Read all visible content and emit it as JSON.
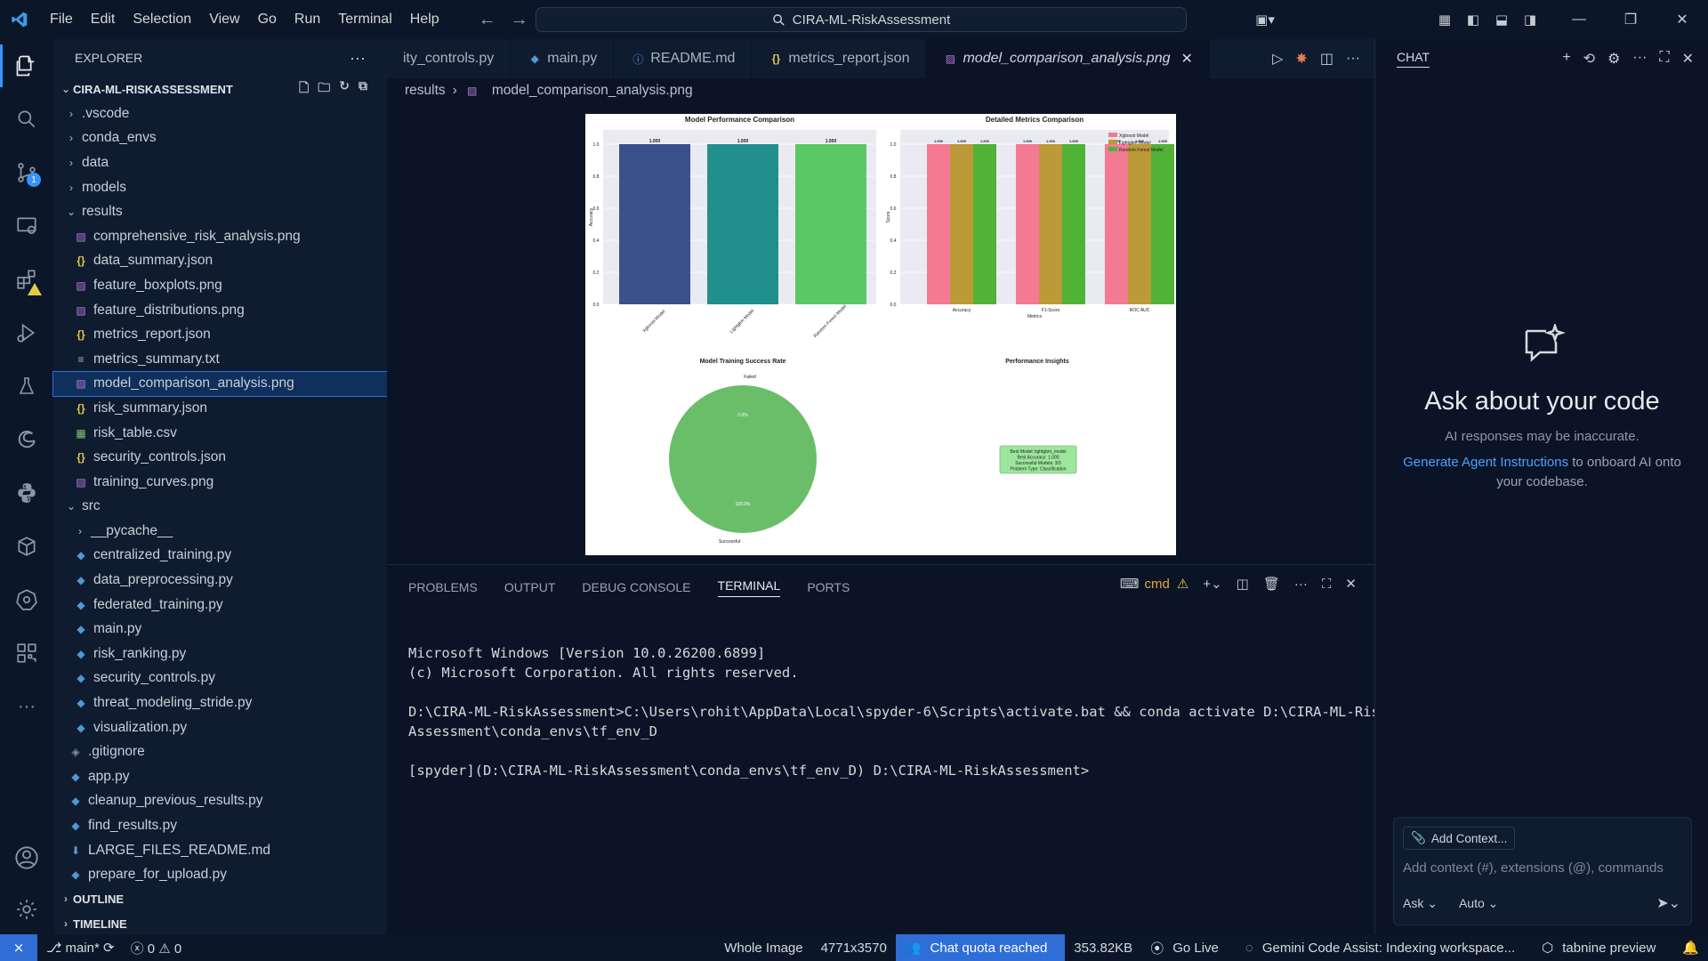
{
  "menu": [
    "File",
    "Edit",
    "Selection",
    "View",
    "Go",
    "Run",
    "Terminal",
    "Help"
  ],
  "search": {
    "label": "CIRA-ML-RiskAssessment"
  },
  "explorer": {
    "title": "EXPLORER",
    "project": "CIRA-ML-RISKASSESSMENT",
    "tree": [
      {
        "label": ".vscode",
        "type": "folder",
        "depth": 1,
        "open": false
      },
      {
        "label": "conda_envs",
        "type": "folder",
        "depth": 1,
        "open": false
      },
      {
        "label": "data",
        "type": "folder",
        "depth": 1,
        "open": false
      },
      {
        "label": "models",
        "type": "folder",
        "depth": 1,
        "open": false
      },
      {
        "label": "results",
        "type": "folder",
        "depth": 1,
        "open": true
      },
      {
        "label": "comprehensive_risk_analysis.png",
        "type": "png",
        "depth": 2
      },
      {
        "label": "data_summary.json",
        "type": "json",
        "depth": 2
      },
      {
        "label": "feature_boxplots.png",
        "type": "png",
        "depth": 2
      },
      {
        "label": "feature_distributions.png",
        "type": "png",
        "depth": 2
      },
      {
        "label": "metrics_report.json",
        "type": "json",
        "depth": 2
      },
      {
        "label": "metrics_summary.txt",
        "type": "txt",
        "depth": 2
      },
      {
        "label": "model_comparison_analysis.png",
        "type": "png",
        "depth": 2,
        "selected": true
      },
      {
        "label": "risk_summary.json",
        "type": "json",
        "depth": 2
      },
      {
        "label": "risk_table.csv",
        "type": "csv",
        "depth": 2
      },
      {
        "label": "security_controls.json",
        "type": "json",
        "depth": 2
      },
      {
        "label": "training_curves.png",
        "type": "png",
        "depth": 2
      },
      {
        "label": "src",
        "type": "folder",
        "depth": 1,
        "open": true
      },
      {
        "label": "__pycache__",
        "type": "folder",
        "depth": 2,
        "open": false
      },
      {
        "label": "centralized_training.py",
        "type": "py",
        "depth": 2
      },
      {
        "label": "data_preprocessing.py",
        "type": "py",
        "depth": 2
      },
      {
        "label": "federated_training.py",
        "type": "py",
        "depth": 2
      },
      {
        "label": "main.py",
        "type": "py",
        "depth": 2
      },
      {
        "label": "risk_ranking.py",
        "type": "py",
        "depth": 2
      },
      {
        "label": "security_controls.py",
        "type": "py",
        "depth": 2
      },
      {
        "label": "threat_modeling_stride.py",
        "type": "py",
        "depth": 2
      },
      {
        "label": "visualization.py",
        "type": "py",
        "depth": 2
      },
      {
        "label": ".gitignore",
        "type": "git",
        "depth": 1
      },
      {
        "label": "app.py",
        "type": "py",
        "depth": 1
      },
      {
        "label": "cleanup_previous_results.py",
        "type": "py",
        "depth": 1
      },
      {
        "label": "find_results.py",
        "type": "py",
        "depth": 1
      },
      {
        "label": "LARGE_FILES_README.md",
        "type": "md",
        "depth": 1
      },
      {
        "label": "prepare_for_upload.py",
        "type": "py",
        "depth": 1
      }
    ],
    "outline": "OUTLINE",
    "timeline": "TIMELINE"
  },
  "tabs": [
    {
      "label": "ity_controls.py",
      "icon": "py"
    },
    {
      "label": "main.py",
      "icon": "py"
    },
    {
      "label": "README.md",
      "icon": "info"
    },
    {
      "label": "metrics_report.json",
      "icon": "json"
    },
    {
      "label": "model_comparison_analysis.png",
      "icon": "png",
      "active": true
    }
  ],
  "breadcrumb": {
    "folder": "results",
    "file": "model_comparison_analysis.png"
  },
  "figure": {
    "chart1": {
      "title": "Model Performance Comparison",
      "ylabel": "Accuracy",
      "categories": [
        "Xgboost Model",
        "Lightgbm Model",
        "Random Forest Model"
      ],
      "values": [
        1.0,
        1.0,
        1.0
      ],
      "value_labels": [
        "1.000",
        "1.000",
        "1.000"
      ],
      "colors": [
        "#3b518b",
        "#21908d",
        "#5ac864"
      ],
      "yticks": [
        "0.0",
        "0.2",
        "0.4",
        "0.6",
        "0.8",
        "1.0"
      ]
    },
    "chart2": {
      "title": "Detailed Metrics Comparison",
      "ylabel": "Score",
      "xlabel": "Metrics",
      "categories": [
        "Accuracy",
        "F1-Score",
        "ROC AUC"
      ],
      "series": [
        {
          "name": "Xgboost Model",
          "color": "#f37a92",
          "values": [
            1.0,
            1.0,
            1.0
          ]
        },
        {
          "name": "Lightgbm Model",
          "color": "#bc9a37",
          "values": [
            1.0,
            1.0,
            1.0
          ]
        },
        {
          "name": "Random Forest Model",
          "color": "#50b338",
          "values": [
            1.0,
            1.0,
            1.0
          ]
        }
      ],
      "value_label": "1.000",
      "yticks": [
        "0.0",
        "0.2",
        "0.4",
        "0.6",
        "0.8",
        "1.0"
      ]
    },
    "chart3": {
      "title": "Model Training Success Rate",
      "slices": [
        {
          "label": "Failed",
          "value": 0,
          "pct": "0.0%"
        },
        {
          "label": "Successful",
          "value": 100,
          "pct": "100.0%"
        }
      ],
      "color": "#6abe6a"
    },
    "chart4": {
      "title": "Performance Insights",
      "lines": [
        "Best Model: lightgbm_model",
        "Best Accuracy: 1.000",
        "Successful Models: 3/3",
        "Problem Type: Classification"
      ]
    }
  },
  "panel": {
    "tabs": [
      "PROBLEMS",
      "OUTPUT",
      "DEBUG CONSOLE",
      "TERMINAL",
      "PORTS"
    ],
    "active_tab": "TERMINAL",
    "shell": "cmd",
    "terminal_lines": [
      "Microsoft Windows [Version 10.0.26200.6899]",
      "(c) Microsoft Corporation. All rights reserved.",
      "",
      "D:\\CIRA-ML-RiskAssessment>C:\\Users\\rohit\\AppData\\Local\\spyder-6\\Scripts\\activate.bat && conda activate D:\\CIRA-ML-Risk",
      "Assessment\\conda_envs\\tf_env_D",
      "",
      "[spyder](D:\\CIRA-ML-RiskAssessment\\conda_envs\\tf_env_D) D:\\CIRA-ML-RiskAssessment>"
    ]
  },
  "chat": {
    "title": "CHAT",
    "heading": "Ask about your code",
    "disclaimer": "AI responses may be inaccurate.",
    "link": "Generate Agent Instructions",
    "link_suffix": " to onboard AI onto your codebase.",
    "add_context": "Add Context...",
    "placeholder": "Add context (#), extensions (@), commands",
    "mode": "Ask",
    "model": "Auto"
  },
  "status": {
    "branch": "main*",
    "errors": "0",
    "warnings": "0",
    "zoom": "Whole Image",
    "dimensions": "4771x3570",
    "quota": "Chat quota reached",
    "size": "353.82KB",
    "golive": "Go Live",
    "gemini": "Gemini Code Assist: Indexing workspace...",
    "tabnine": "tabnine preview"
  }
}
